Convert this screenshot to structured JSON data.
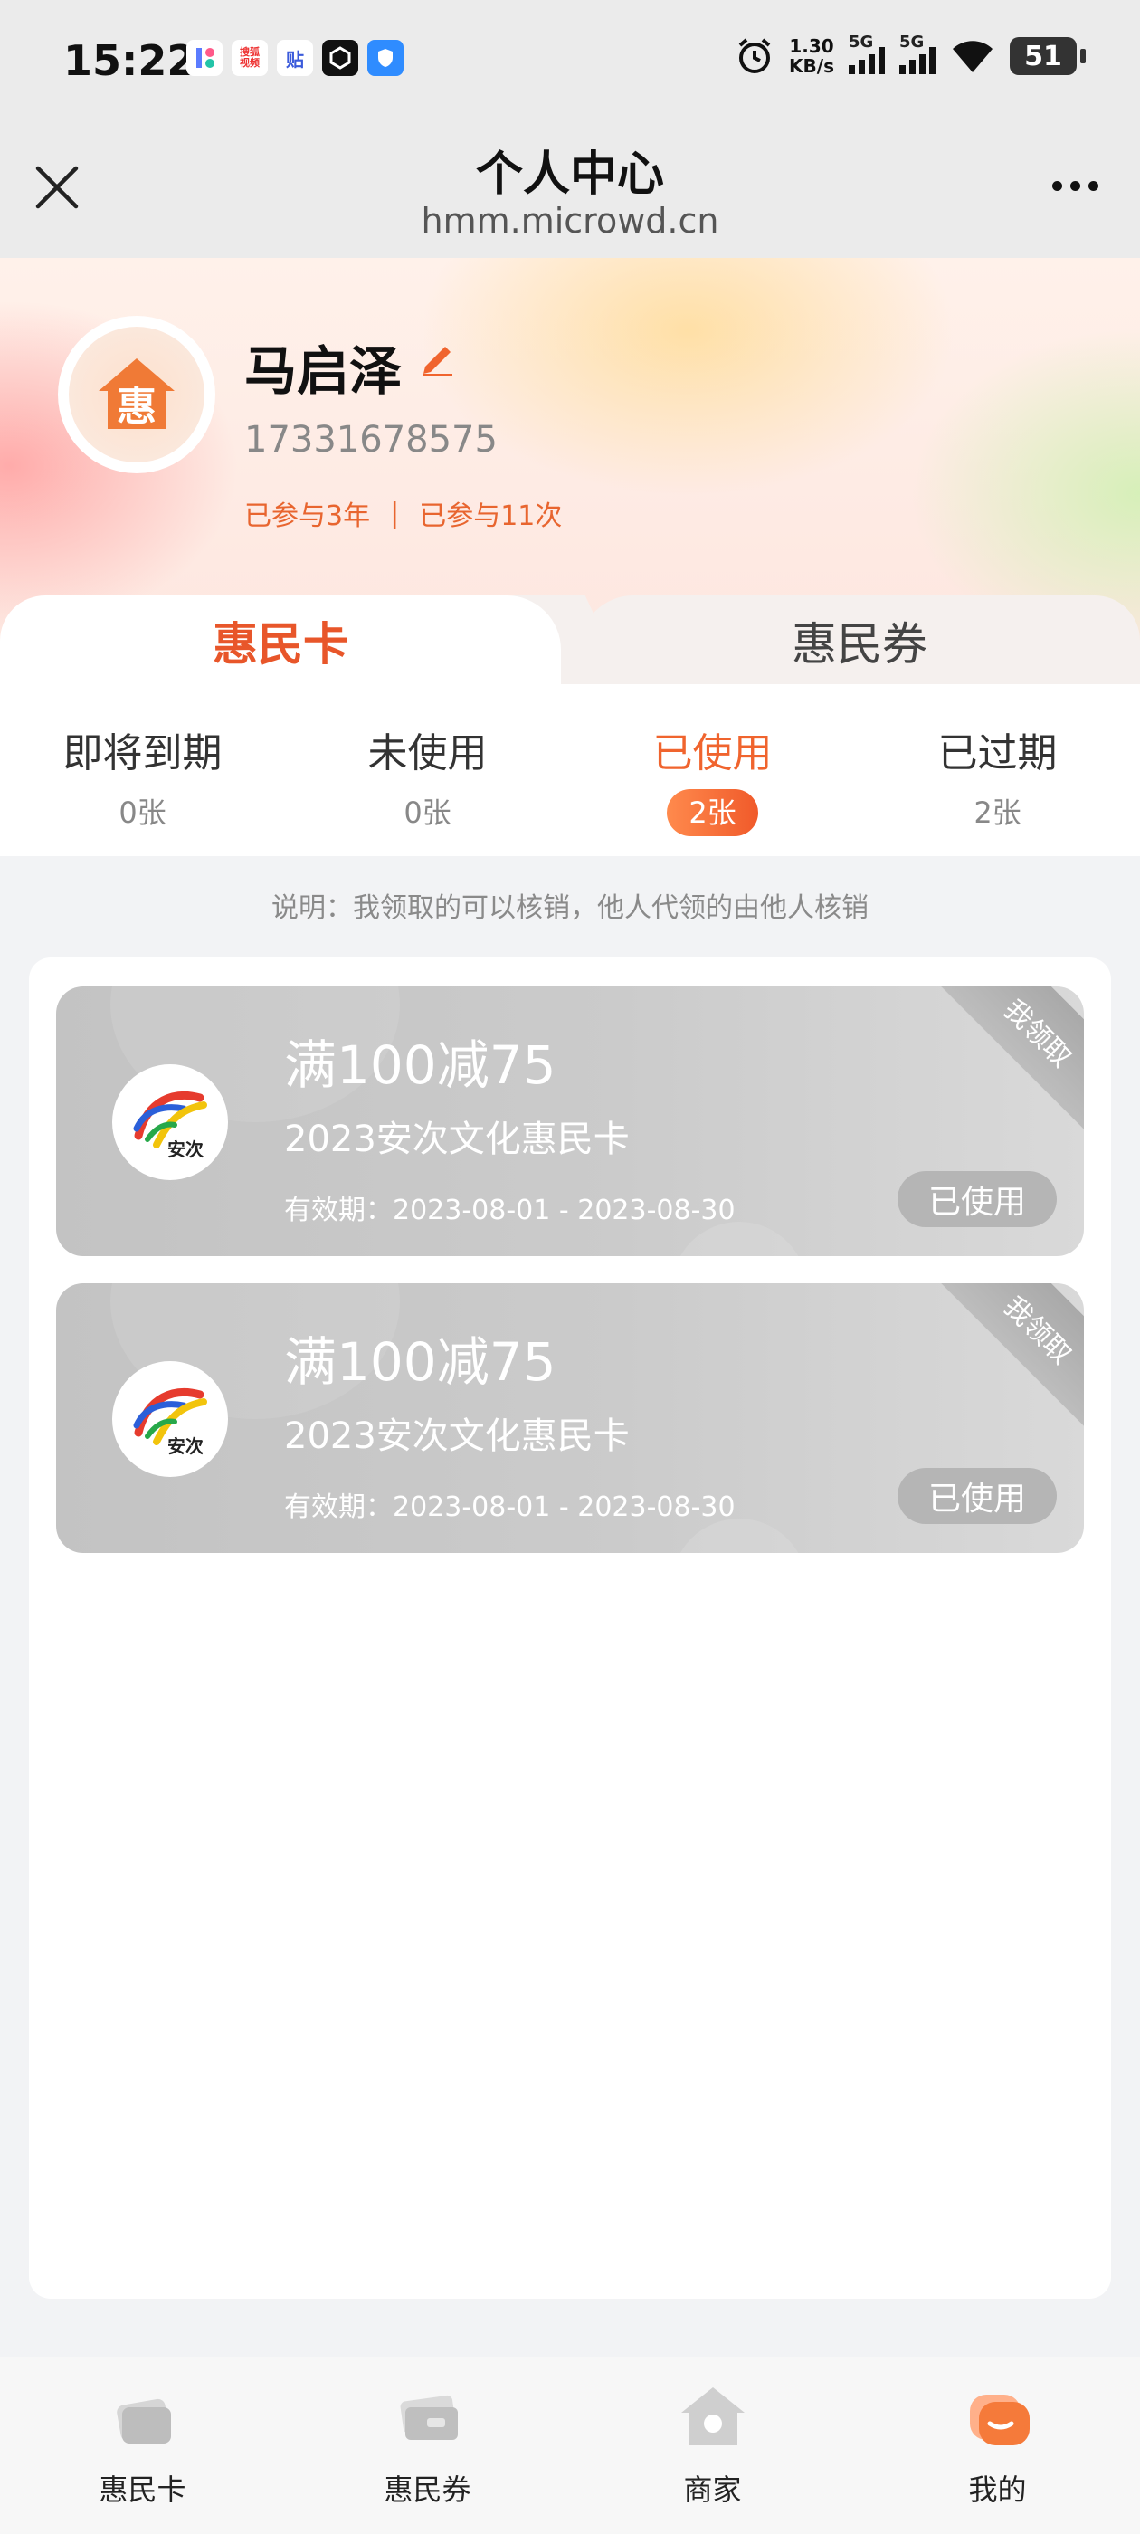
{
  "status_bar": {
    "time": "15:22",
    "speed_value": "1.30",
    "speed_unit": "KB/s",
    "network1": "5G",
    "network2": "5G",
    "battery": "51",
    "app_badge_text": "搜狐视频"
  },
  "header": {
    "title": "个人中心",
    "url": "hmm.microwd.cn"
  },
  "profile": {
    "avatar_char": "惠",
    "name": "马启泽",
    "phone": "17331678575",
    "years_joined": "已参与3年",
    "separator": "|",
    "times_joined": "已参与11次"
  },
  "main_tabs": [
    {
      "label": "惠民卡",
      "active": true
    },
    {
      "label": "惠民券",
      "active": false
    }
  ],
  "sub_tabs": [
    {
      "label": "即将到期",
      "count": "0张"
    },
    {
      "label": "未使用",
      "count": "0张"
    },
    {
      "label": "已使用",
      "count": "2张"
    },
    {
      "label": "已过期",
      "count": "2张"
    }
  ],
  "note": "说明：我领取的可以核销，他人代领的由他人核销",
  "cards": [
    {
      "title": "满100减75",
      "subtitle": "2023安次文化惠民卡",
      "validity": "有效期：2023-08-01 - 2023-08-30",
      "status": "已使用",
      "corner": "我领取",
      "logo_text": "安次"
    },
    {
      "title": "满100减75",
      "subtitle": "2023安次文化惠民卡",
      "validity": "有效期：2023-08-01 - 2023-08-30",
      "status": "已使用",
      "corner": "我领取",
      "logo_text": "安次"
    }
  ],
  "bottom_nav": [
    {
      "label": "惠民卡",
      "icon": "card-icon"
    },
    {
      "label": "惠民券",
      "icon": "ticket-icon"
    },
    {
      "label": "商家",
      "icon": "store-icon"
    },
    {
      "label": "我的",
      "icon": "profile-icon"
    }
  ],
  "colors": {
    "accent": "#f0642e",
    "tab_active": "#e8562a",
    "card_gray": "#c6c6c6"
  }
}
